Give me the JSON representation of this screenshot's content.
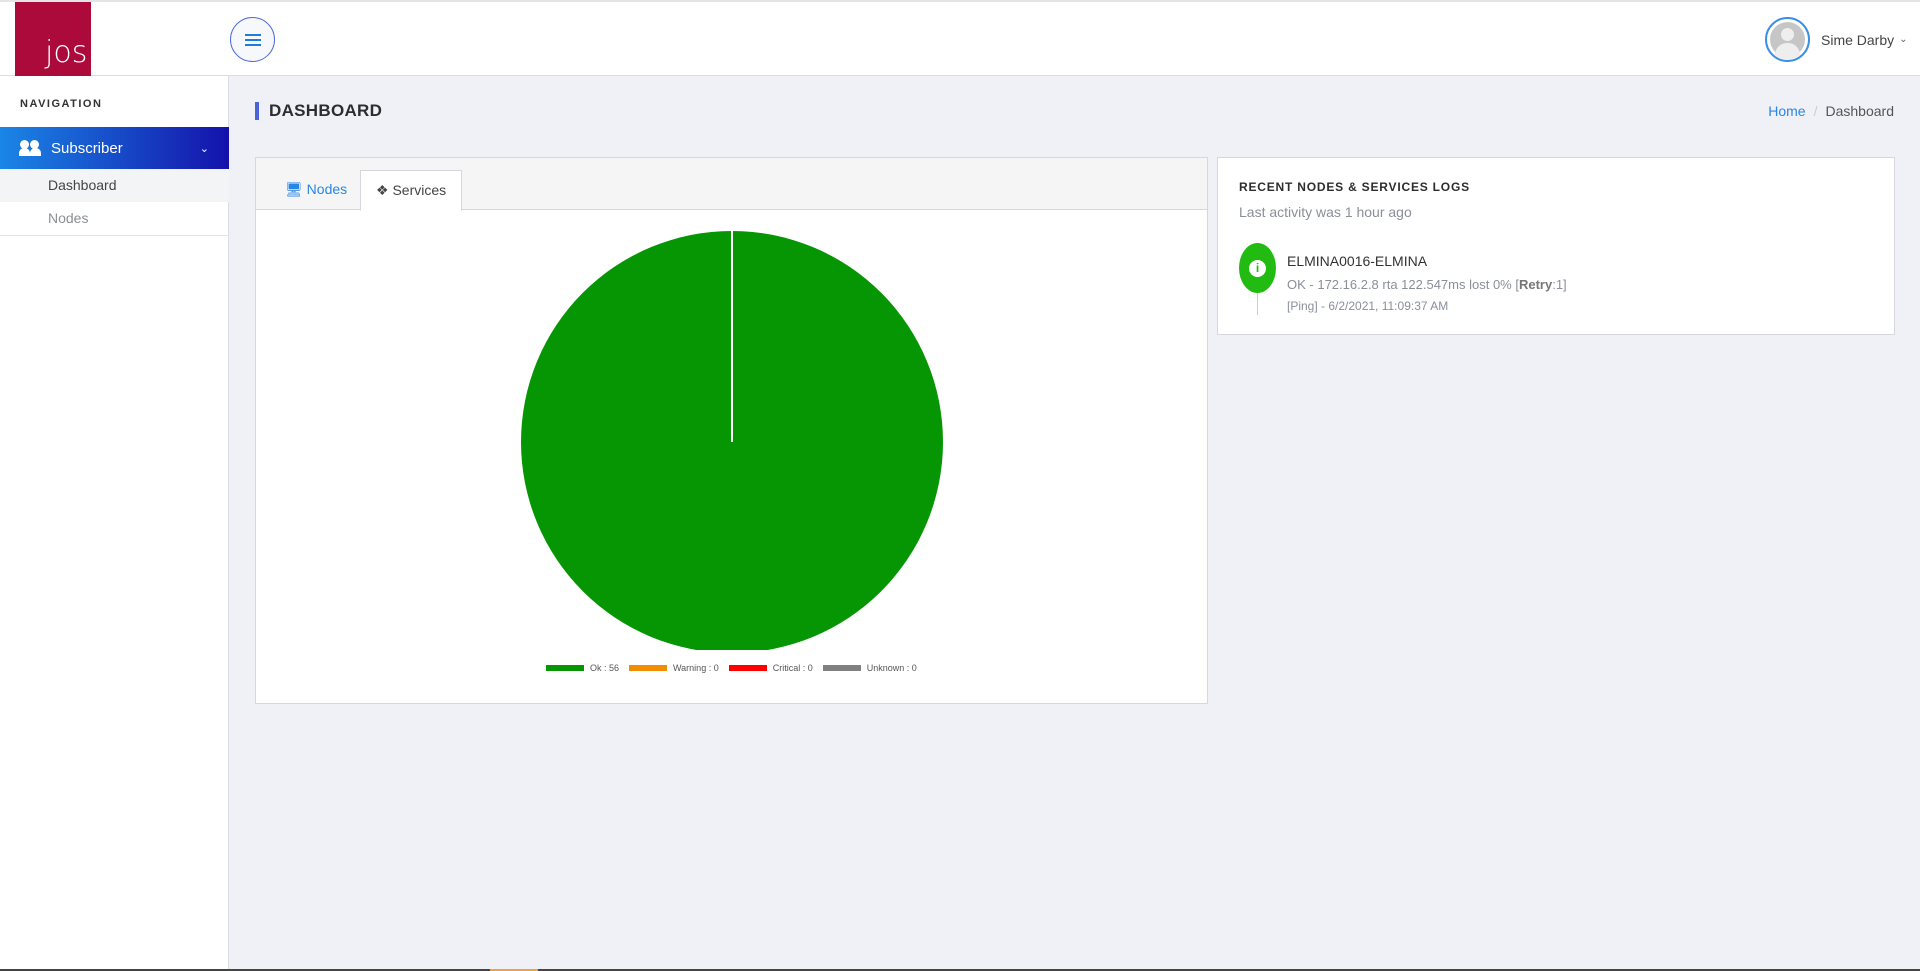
{
  "header": {
    "logo_text": "jos",
    "user_name": "Sime Darby"
  },
  "sidebar": {
    "nav_label": "NAVIGATION",
    "group": "Subscriber",
    "items": [
      {
        "label": "Dashboard"
      },
      {
        "label": "Nodes"
      }
    ]
  },
  "page": {
    "title": "DASHBOARD",
    "breadcrumb": {
      "home": "Home",
      "sep": "/",
      "current": "Dashboard"
    }
  },
  "tabs": [
    {
      "label": "Nodes"
    },
    {
      "label": "Services"
    }
  ],
  "chart_data": {
    "type": "pie",
    "categories": [
      "Ok",
      "Warning",
      "Critical",
      "Unknown"
    ],
    "values": [
      56,
      0,
      0,
      0
    ],
    "colors": [
      "#069603",
      "#f28c00",
      "#ff0000",
      "#808080"
    ],
    "legend_labels": [
      "Ok : 56",
      "Warning : 0",
      "Critical : 0",
      "Unknown : 0"
    ],
    "legend": "bottom"
  },
  "logs": {
    "title": "RECENT NODES & SERVICES LOGS",
    "subtitle": "Last activity was 1 hour ago",
    "entries": [
      {
        "name": "ELMINA0016-ELMINA",
        "message": "OK - 172.16.2.8 rta 122.547ms lost 0% [",
        "retry_label": "Retry",
        "retry_value": ":1]",
        "time": "[Ping] - 6/2/2021, 11:09:37 AM"
      }
    ]
  }
}
